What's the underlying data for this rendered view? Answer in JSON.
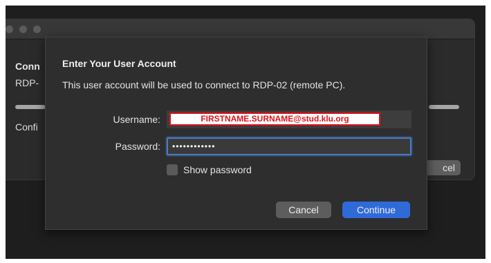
{
  "background_window": {
    "title_partial": "Conn",
    "subtitle_partial": "RDP-",
    "status_partial": "Confi",
    "cancel_partial": "cel"
  },
  "dialog": {
    "title": "Enter Your User Account",
    "message": "This user account will be used to connect to RDP-02 (remote PC).",
    "username_label": "Username:",
    "username_value": "FIRSTNAME.SURNAME@stud.klu.org",
    "password_label": "Password:",
    "password_value": "••••••••••••",
    "show_password_label": "Show password",
    "show_password_checked": false,
    "cancel_label": "Cancel",
    "continue_label": "Continue"
  },
  "colors": {
    "accent": "#2f6ad9",
    "redaction_border": "#e0111a"
  }
}
